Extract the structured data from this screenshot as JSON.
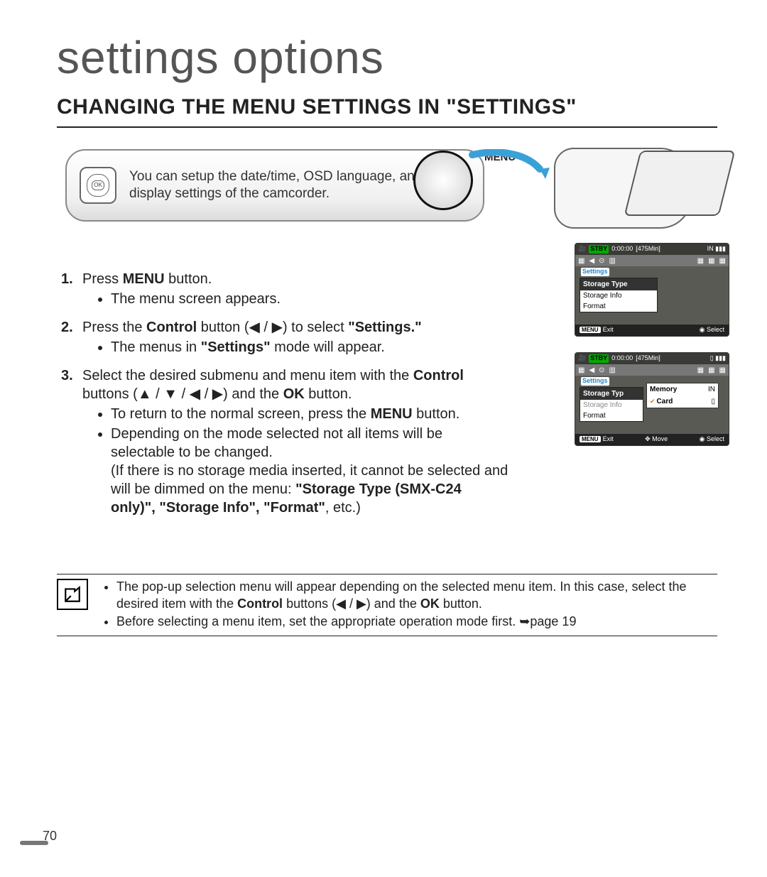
{
  "page_title": "settings options",
  "section_title": "CHANGING THE MENU SETTINGS IN \"SETTINGS\"",
  "intro": {
    "ok_label": "OK",
    "menu_label": "MENU",
    "text": "You can setup the date/time, OSD language, and display settings of the camcorder."
  },
  "steps": [
    {
      "num": "1.",
      "lead_a": "Press ",
      "lead_bold": "MENU",
      "lead_b": " button.",
      "bullets": [
        "The menu screen appears."
      ]
    },
    {
      "num": "2.",
      "lead_a": "Press the ",
      "lead_bold": "Control",
      "lead_b": " button (◀ / ▶) to select ",
      "lead_bold2": "\"Settings.\"",
      "bullets_html": [
        "The menus in <b>\"Settings\"</b> mode will appear."
      ]
    },
    {
      "num": "3.",
      "lead_a": "Select the desired submenu and menu item with the ",
      "lead_bold": "Control",
      "lead_b": " buttons (▲ / ▼ / ◀ / ▶) and the ",
      "lead_bold2": "OK",
      "lead_c": " button.",
      "bullets_html": [
        "To return to the normal screen, press the <b>MENU</b> button.",
        "Depending on the mode selected not all items will be selectable to be changed.<br>(If there is no storage media inserted, it cannot be selected and will be dimmed on the menu: <b>\"Storage Type (SMX-C24 only)\", \"Storage Info\", \"Format\"</b>, etc.)"
      ]
    }
  ],
  "screenshots": {
    "stby": "STBY",
    "time": "0:00:00",
    "remain": "[475Min]",
    "tab_label": "Settings",
    "menu_items": [
      "Storage Type",
      "Storage Info",
      "Format"
    ],
    "popup": {
      "memory": "Memory",
      "card": "Card"
    },
    "buttons": {
      "menu": "MENU",
      "exit": "Exit",
      "move": "Move",
      "select": "Select"
    }
  },
  "notes": [
    "The pop-up selection menu will appear depending on the selected menu item. In this case, select the desired item with the <b>Control</b> buttons (◀ / ▶) and the <b>OK</b> button.",
    "Before selecting a menu item, set the appropriate operation mode first. ➥page 19"
  ],
  "page_number": "70"
}
